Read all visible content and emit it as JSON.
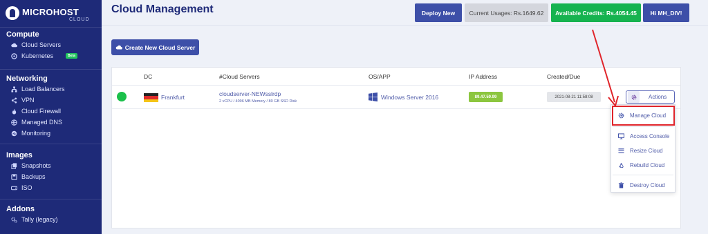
{
  "brand": {
    "name": "MICROHOST",
    "sub": "CLOUD"
  },
  "sidebar": {
    "sections": [
      {
        "title": "Compute",
        "items": [
          {
            "label": "Cloud Servers",
            "icon": "cloud-icon"
          },
          {
            "label": "Kubernetes",
            "icon": "kubernetes-icon",
            "badge": "Beta"
          }
        ]
      },
      {
        "title": "Networking",
        "items": [
          {
            "label": "Load Balancers",
            "icon": "network-icon"
          },
          {
            "label": "VPN",
            "icon": "share-icon"
          },
          {
            "label": "Cloud Firewall",
            "icon": "fire-icon"
          },
          {
            "label": "Managed DNS",
            "icon": "globe-icon"
          },
          {
            "label": "Monitoring",
            "icon": "monitor-icon"
          }
        ]
      },
      {
        "title": "Images",
        "items": [
          {
            "label": "Snapshots",
            "icon": "copy-icon"
          },
          {
            "label": "Backups",
            "icon": "backup-icon"
          },
          {
            "label": "ISO",
            "icon": "disk-icon"
          }
        ]
      },
      {
        "title": "Addons",
        "items": [
          {
            "label": "Tally (legacy)",
            "icon": "cogs-icon"
          }
        ]
      }
    ]
  },
  "header": {
    "title": "Cloud Management",
    "deploy": "Deploy New",
    "usage": "Current Usages: Rs.1649.62",
    "credits": "Available Credits: Rs.4054.45",
    "greeting": "Hi MH_DIV!"
  },
  "create_button": "Create New Cloud Server",
  "table": {
    "headers": {
      "dc": "DC",
      "servers": "#Cloud Servers",
      "os": "OS/APP",
      "ip": "IP Address",
      "created": "Created/Due"
    },
    "row": {
      "status_color": "#1bc04b",
      "dc": "Frankfurt",
      "server_name": "cloudserver-NEWsslrdp",
      "server_spec": "2 vCPU / 4096 MB Memory / 80 GB SSD Disk",
      "os": "Windows Server 2016",
      "ip": "89.47.59.99",
      "created": "2021-08-21 11:58:08",
      "actions": "Actions"
    }
  },
  "dropdown": {
    "manage": "Manage Cloud",
    "console": "Access Console",
    "resize": "Resize Cloud",
    "rebuild": "Rebuild Cloud",
    "destroy": "Destroy Cloud"
  },
  "colors": {
    "sidebar": "#1e2a78",
    "primary": "#3d4fa8",
    "success": "#16b34f",
    "annotation": "#e0242a"
  }
}
